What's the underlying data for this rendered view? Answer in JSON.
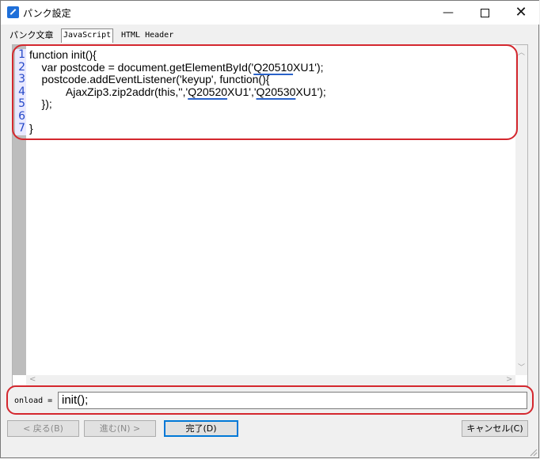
{
  "window": {
    "title": "パンク設定",
    "minimize": "—",
    "close": "✕"
  },
  "tabs": [
    {
      "label": "パンク文章"
    },
    {
      "label": "JavaScript"
    },
    {
      "label": "HTML Header"
    }
  ],
  "editor": {
    "line_numbers": [
      "1",
      "2",
      "3",
      "4",
      "5",
      "6",
      "7"
    ],
    "lines": {
      "l1": "function init(){",
      "l2a": "    var postcode = document.getElementById('",
      "l2b": "Q20510",
      "l2c": "XU1');",
      "l3": "    postcode.addEventListener('keyup', function(){",
      "l4a": "            AjaxZip3.zip2addr(this,'','",
      "l4b": "Q20520",
      "l4c": "XU1','",
      "l4d": "Q20530",
      "l4e": "XU1');",
      "l5": "    });",
      "l6": "",
      "l7": "}"
    }
  },
  "onload": {
    "label": "onload =",
    "value": "init();"
  },
  "buttons": {
    "back": "< 戻る(B)",
    "next": "進む(N) >",
    "done": "完了(D)",
    "cancel": "キャンセル(C)"
  },
  "colors": {
    "highlight": "#d4272e",
    "line_numbers": "#2448c8",
    "squiggle": "#2a62c9"
  }
}
